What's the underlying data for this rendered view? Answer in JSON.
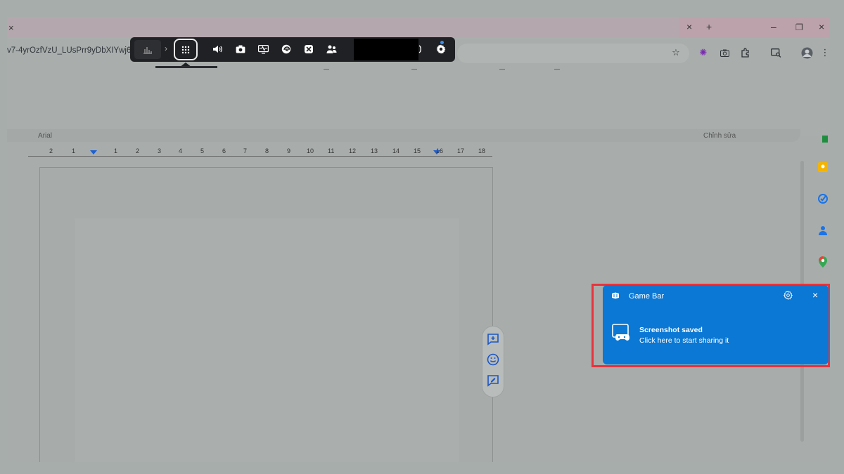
{
  "browser": {
    "tab_close": "×",
    "new_tab": "+",
    "minimize": "–",
    "maximize": "❐",
    "close": "×",
    "url_fragment": "v7-4yrOzfVzU_LUsPrr9yDbXIYwj6Ho"
  },
  "docs": {
    "font_name": "Arial",
    "editing_mode": "Chỉnh sửa",
    "ruler_numbers": [
      "2",
      "1",
      "1",
      "2",
      "3",
      "4",
      "5",
      "6",
      "7",
      "8",
      "9",
      "10",
      "11",
      "12",
      "13",
      "14",
      "15",
      "16",
      "17",
      "18"
    ]
  },
  "gamebar": {
    "widget_label": "Game Bar widget menu"
  },
  "toast": {
    "app_name": "Game Bar",
    "title": "Screenshot saved",
    "body": "Click here to start sharing it"
  },
  "colors": {
    "toast_bg": "#0a78d4",
    "highlight": "#e8323c",
    "gamebar_bg": "#202124"
  }
}
